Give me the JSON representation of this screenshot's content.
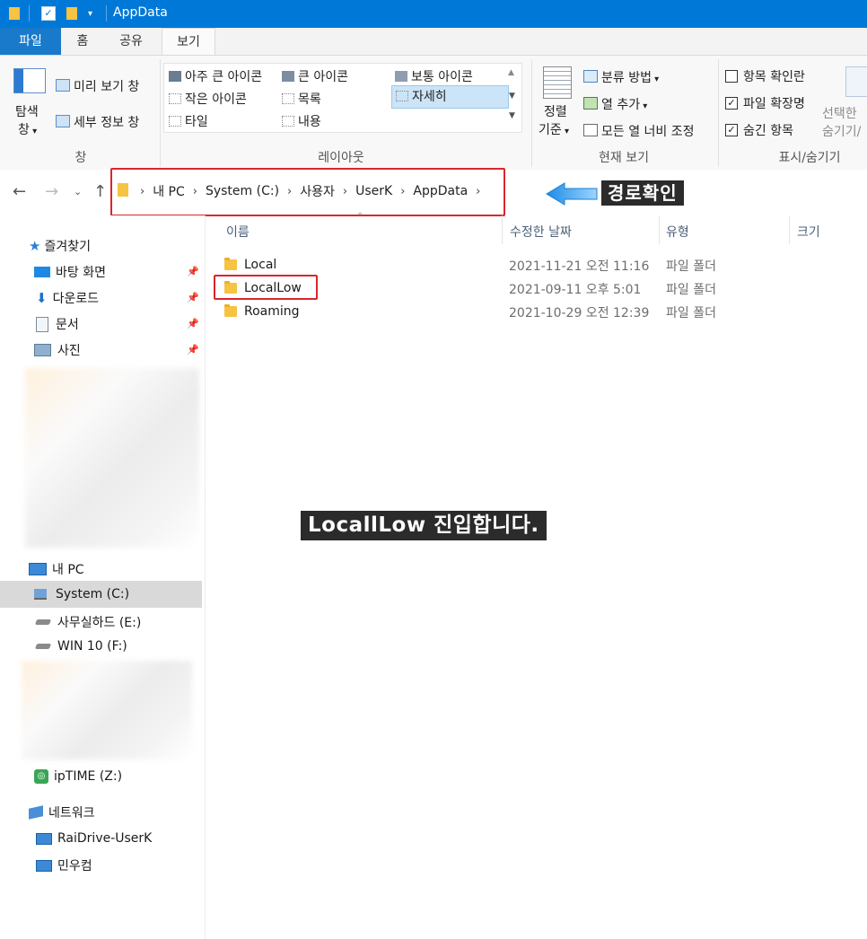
{
  "window": {
    "title": "AppData"
  },
  "tabs": [
    {
      "label": "파일"
    },
    {
      "label": "홈"
    },
    {
      "label": "공유"
    },
    {
      "label": "보기"
    }
  ],
  "ribbon": {
    "pane": {
      "nav_pane_line1": "탐색",
      "nav_pane_line2": "창",
      "preview_pane": "미리 보기 창",
      "details_pane": "세부 정보 창",
      "label": "창"
    },
    "layout": {
      "items": [
        "아주 큰 아이콘",
        "큰 아이콘",
        "보통 아이콘",
        "작은 아이콘",
        "목록",
        "자세히",
        "타일",
        "내용"
      ],
      "label": "레이아웃"
    },
    "current_view": {
      "sort_line1": "정렬",
      "sort_line2": "기준",
      "group_by": "분류 방법",
      "add_columns": "열 추가",
      "size_all_columns": "모든 열 너비 조정",
      "label": "현재 보기"
    },
    "show_hide": {
      "item_checkboxes": "항목 확인란",
      "file_extensions": "파일 확장명",
      "hidden_items": "숨긴 항목",
      "hide_selected_line1": "선택한",
      "hide_selected_line2": "숨기기/",
      "label": "표시/숨기기"
    }
  },
  "address": {
    "crumbs": [
      "내 PC",
      "System (C:)",
      "사용자",
      "UserK",
      "AppData"
    ],
    "callout": "경로확인"
  },
  "sidebar": {
    "quick_access": "즐겨찾기",
    "quick_items": [
      "바탕 화면",
      "다운로드",
      "문서",
      "사진"
    ],
    "this_pc": "내 PC",
    "drives": [
      "System (C:)",
      "사무실하드 (E:)",
      "WIN 10 (F:)"
    ],
    "iptime": "ipTIME (Z:)",
    "network": "네트워크",
    "network_items": [
      "RaiDrive-UserK",
      "민우컴"
    ]
  },
  "columns": {
    "name": "이름",
    "modified": "수정한 날짜",
    "type": "유형",
    "size": "크기"
  },
  "files": [
    {
      "name": "Local",
      "modified": "2021-11-21 오전 11:16",
      "type": "파일 폴더"
    },
    {
      "name": "LocalLow",
      "modified": "2021-09-11 오후 5:01",
      "type": "파일 폴더"
    },
    {
      "name": "Roaming",
      "modified": "2021-10-29 오전 12:39",
      "type": "파일 폴더"
    }
  ],
  "annotation": {
    "center_caption": "LocallLow 진입합니다."
  },
  "colors": {
    "titlebar": "#0078d7",
    "accent_red": "#d9262c",
    "callout_bg": "#2b2b2b",
    "arrow": "#3fa0ea"
  }
}
